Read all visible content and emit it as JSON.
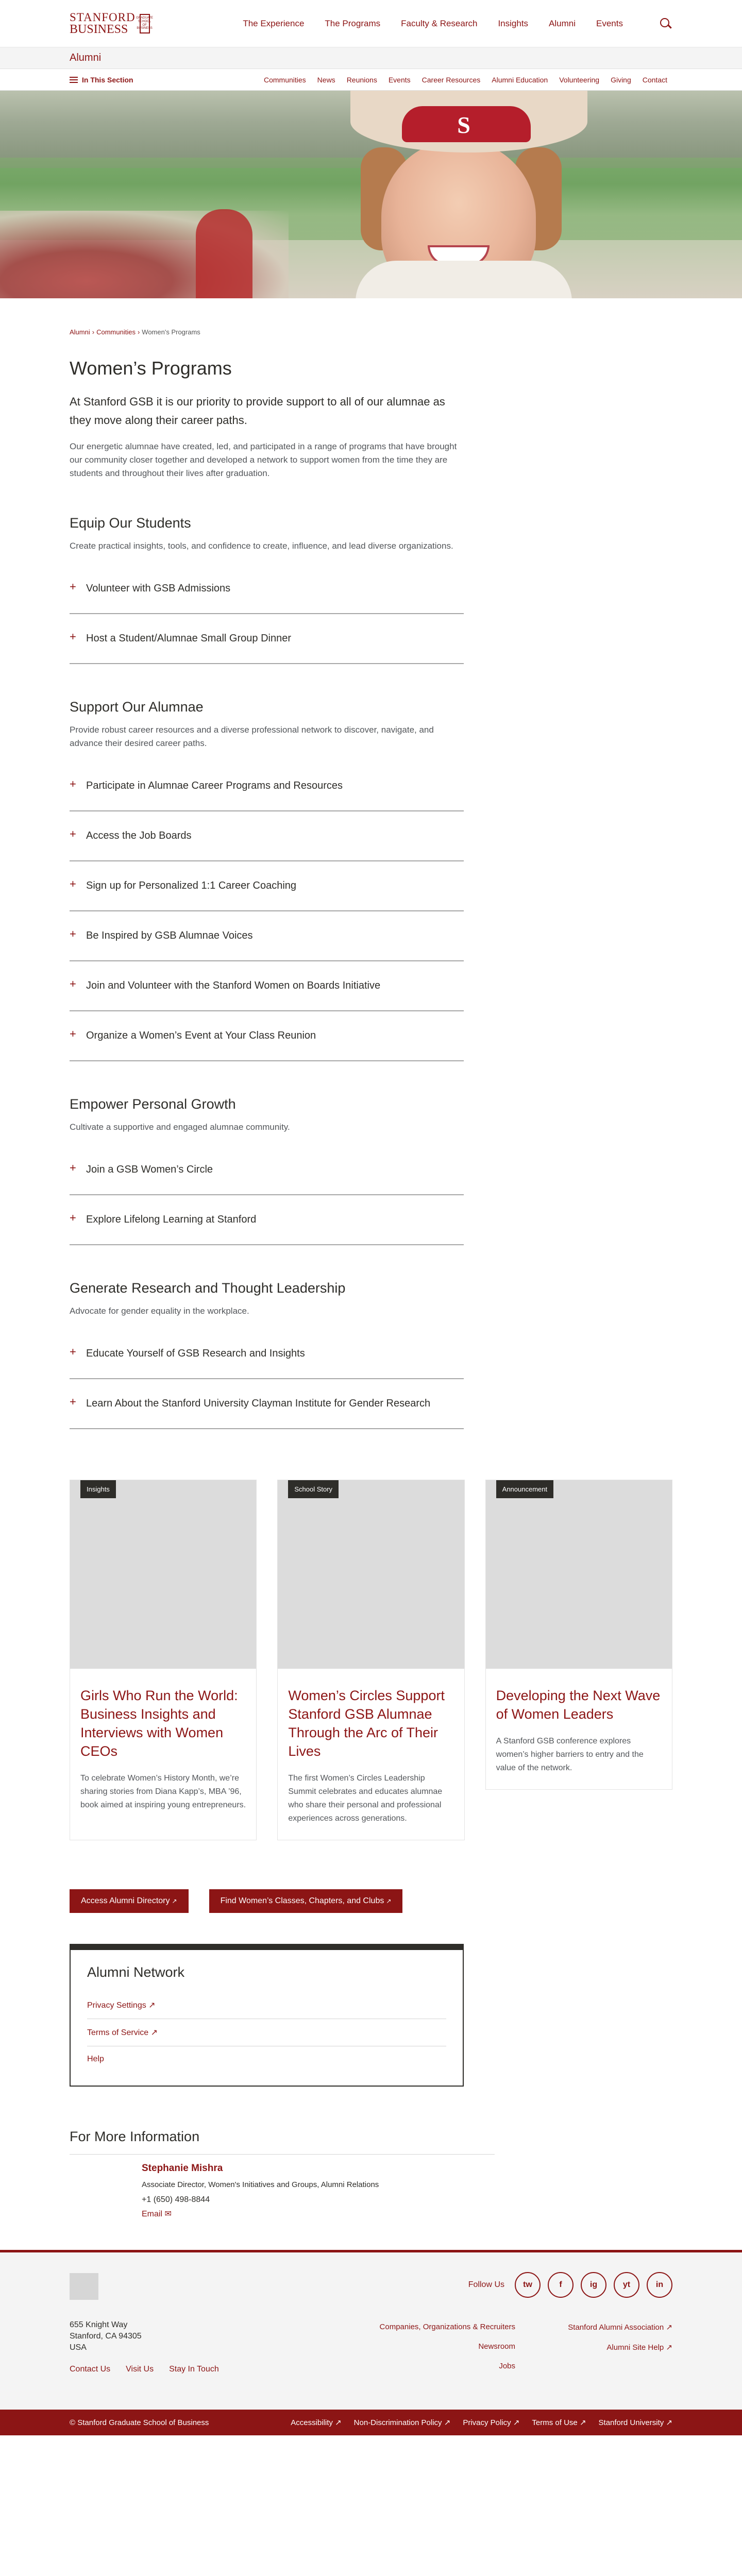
{
  "brand": {
    "line1": "STANFORD",
    "line2": "BUSINESS",
    "box": "GRADUATE SCHOOL OF BUSINESS"
  },
  "main_menu": [
    "The Experience",
    "The Programs",
    "Faculty & Research",
    "Insights",
    "Alumni",
    "Events"
  ],
  "section": {
    "title": "Alumni"
  },
  "subnav": {
    "label": "In This Section",
    "links": [
      "Communities",
      "News",
      "Reunions",
      "Events",
      "Career Resources",
      "Alumni Education",
      "Volunteering",
      "Giving",
      "Contact"
    ]
  },
  "hero": {
    "hat_letter": "S"
  },
  "breadcrumb": {
    "items": [
      "Alumni",
      "Communities"
    ],
    "current": "Women's Programs",
    "sep": "›"
  },
  "page": {
    "title": "Women’s Programs",
    "lead": "At Stanford GSB it is our priority to provide support to all of our alumnae as they move along their career paths.",
    "intro": "Our energetic alumnae have created, led, and participated in a range of programs that have brought our community closer together and developed a network to support women from the time they are students and throughout their lives after graduation."
  },
  "groups": [
    {
      "title": "Equip Our Students",
      "desc": "Create practical insights, tools, and confidence to create, influence, and lead diverse organizations.",
      "items": [
        "Volunteer with GSB Admissions",
        "Host a Student/Alumnae Small Group Dinner"
      ]
    },
    {
      "title": "Support Our Alumnae",
      "desc": "Provide robust career resources and a diverse professional network to discover, navigate, and advance their desired career paths.",
      "items": [
        "Participate in Alumnae Career Programs and Resources",
        "Access the Job Boards",
        "Sign up for Personalized 1:1 Career Coaching",
        "Be Inspired by GSB Alumnae Voices",
        "Join and Volunteer with the Stanford Women on Boards Initiative",
        "Organize a Women’s Event at Your Class Reunion"
      ]
    },
    {
      "title": "Empower Personal Growth",
      "desc": "Cultivate a supportive and engaged alumnae community.",
      "items": [
        "Join a GSB Women’s Circle",
        "Explore Lifelong Learning at Stanford"
      ]
    },
    {
      "title": "Generate Research and Thought Leadership",
      "desc": "Advocate for gender equality in the workplace.",
      "items": [
        "Educate Yourself of GSB Research and Insights",
        "Learn About the Stanford University Clayman Institute for Gender Research"
      ]
    }
  ],
  "cards": [
    {
      "tag": "Insights",
      "title": "Girls Who Run the World: Business Insights and Interviews with Women CEOs",
      "text": "To celebrate Women’s History Month, we’re sharing stories from Diana Kapp’s, MBA ’96, book aimed at inspiring young entrepreneurs."
    },
    {
      "tag": "School Story",
      "title": "Women’s Circles Support Stanford GSB Alumnae Through the Arc of Their Lives",
      "text": "The first Women’s Circles Leadership Summit celebrates and educates alumnae who share their personal and professional experiences across generations."
    },
    {
      "tag": "Announcement",
      "title": "Developing the Next Wave of Women Leaders",
      "text": "A Stanford GSB conference explores women’s higher barriers to entry and the value of the network."
    }
  ],
  "buttons": [
    "Access Alumni Directory",
    "Find Women’s Classes, Chapters, and Clubs"
  ],
  "ext_icon": "↗",
  "network": {
    "title": "Alumni Network",
    "links": [
      "Privacy Settings",
      "Terms of Service",
      "Help"
    ]
  },
  "more_info": {
    "title": "For More Information",
    "name": "Stephanie Mishra",
    "role": "Associate Director, Women's Initiatives and Groups, Alumni Relations",
    "phone": "+1 (650) 498-8844",
    "email": "Email"
  },
  "footer": {
    "follow": "Follow Us",
    "social": [
      "tw",
      "f",
      "ig",
      "yt",
      "in"
    ],
    "address": [
      "655 Knight Way",
      "Stanford, CA 94305",
      "USA"
    ],
    "links": [
      "Contact Us",
      "Visit Us",
      "Stay In Touch"
    ],
    "mid_links": [
      "Companies, Organizations & Recruiters",
      "Newsroom",
      "Jobs"
    ],
    "right_links": [
      "Stanford Alumni Association",
      "Alumni Site Help"
    ]
  },
  "bottom": {
    "copyright": "© Stanford Graduate School of Business",
    "links": [
      "Accessibility",
      "Non-Discrimination Policy",
      "Privacy Policy",
      "Terms of Use",
      "Stanford University"
    ]
  },
  "colors": {
    "accent": "#8c1515",
    "text": "#2e2d29",
    "muted": "#53565a"
  }
}
